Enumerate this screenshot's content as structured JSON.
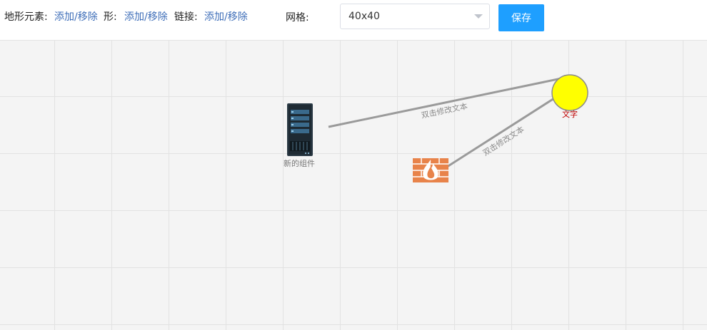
{
  "toolbar": {
    "terrain_label": "地形元素:",
    "terrain_link": "添加/移除",
    "shape_label": "形:",
    "shape_link": "添加/移除",
    "link_label": "链接:",
    "link_link": "添加/移除",
    "grid_label": "网格:",
    "grid_value": "40x40",
    "save_label": "保存"
  },
  "canvas": {
    "nodes": {
      "server": {
        "label": "新的组件",
        "icon": "server-icon"
      },
      "firewall": {
        "icon": "firewall-icon"
      },
      "circle": {
        "label": "文字",
        "fill": "#ffff00"
      }
    },
    "links": {
      "server_to_circle": "双击修改文本",
      "firewall_to_circle": "双击修改文本"
    }
  },
  "colors": {
    "accent": "#1e9fff",
    "link": "#3d6db8",
    "edge": "#9a9a9a",
    "circle_label": "#c00000",
    "firewall": "#e8834a"
  }
}
